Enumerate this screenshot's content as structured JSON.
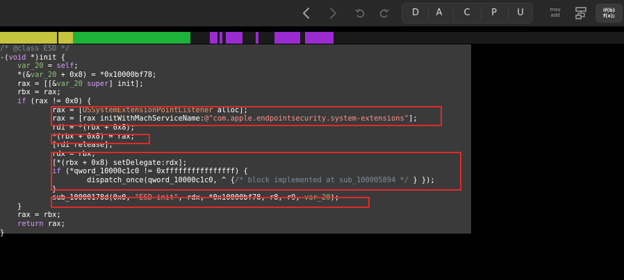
{
  "toolbar": {
    "back_icon": "chevron-left-icon",
    "forward_icon": "chevron-right-icon",
    "undo_icon": "undo-icon",
    "redo_icon": "redo-icon",
    "modes": [
      "D",
      "A",
      "C",
      "P",
      "U"
    ],
    "mov_label_top": "mov",
    "mov_label_bottom": "add",
    "graph_icon": "graph-view-icon",
    "pseudo_label_top": "if(b)",
    "pseudo_label_bottom": "f(x);"
  },
  "navigation_band": {
    "colors": {
      "data": "#c6c33f",
      "code": "#1db23a",
      "procedure": "#9a2bd0",
      "unexplored": "#1a1a1a"
    }
  },
  "code": {
    "line1": "/* @class ESD */",
    "line2_a": "-(",
    "line2_kw": "void",
    "line2_b": " *)init {",
    "line3_a": "var_20",
    "line3_b": " = ",
    "line3_c": "self",
    "line3_d": ";",
    "line4_a": "*(&",
    "line4_b": "var_20",
    "line4_c": " + 0x8) = *0x10000bf78;",
    "line5_a": "rax = [[&",
    "line5_b": "var_20",
    "line5_c": " ",
    "line5_d": "super",
    "line5_e": "] init];",
    "line6": "rbx = rax;",
    "line7_a": "if",
    "line7_b": " (rax != 0x0) {",
    "line8_a": "rax = [",
    "line8_b": "OSSystemExtensionPointListener",
    "line8_c": " alloc];",
    "line9_a": "rax = [rax initWithMachServiceName:",
    "line9_b": "@\"com.apple.endpointsecurity.system-extensions\"",
    "line9_c": "];",
    "line10": "rdi = *(rbx + 0x8);",
    "line11": "*(rbx + 0x8) = rax;",
    "line12": "[rdi release];",
    "line13": "rdx = rbx;",
    "line14": "[*(rbx + 0x8) setDelegate:rdx];",
    "line15_a": "if",
    "line15_b": " (*qword_10000c1c0 != 0xffffffffffffffff) {",
    "line16_a": "dispatch_once(qword_10000c1c0, ^ {",
    "line16_b": "/* block implemented at sub_100005894 */",
    "line16_c": " } });",
    "line17": "}",
    "line18_a": "sub_10000178d(0x0, ",
    "line18_b": "\"ESD init\"",
    "line18_c": ", rdx, *0x10000bf78, r8, r9, ",
    "line18_d": "var_20",
    "line18_e": ");",
    "line19": "}",
    "line20": "rax = rbx;",
    "line21_a": "return",
    "line21_b": " rax;",
    "line22": "}"
  },
  "colors": {
    "comment": "#7d8d99",
    "keyword": "#d59bff",
    "variable": "#8ec07c",
    "string": "#ff8f8f",
    "class_name": "#f39a6b",
    "highlight_box": "#e02b28"
  }
}
